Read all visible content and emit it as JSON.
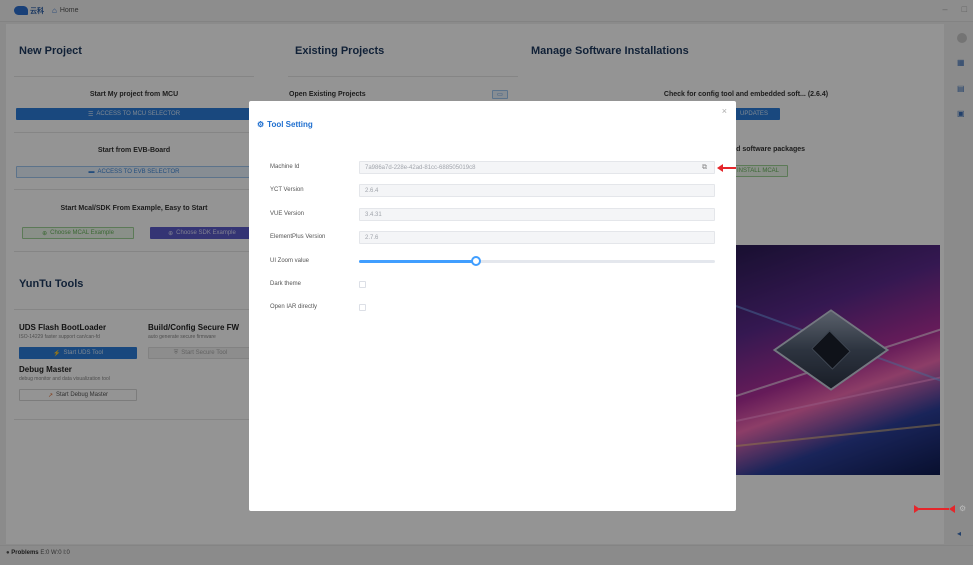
{
  "app": {
    "logo_text": "云科",
    "home_tab": "Home"
  },
  "sections": {
    "new_project": "New Project",
    "existing_projects": "Existing Projects",
    "manage": "Manage Software Installations",
    "yuntu_tools": "YunTu Tools"
  },
  "cards": {
    "mcu_title": "Start My project from MCU",
    "mcu_button": "ACCESS TO MCU SELECTOR",
    "evb_title": "Start from EVB-Board",
    "evb_button": "ACCESS TO EVB SELECTOR",
    "example_title": "Start Mcal/SDK From Example, Easy to Start",
    "mcal_example_button": "Choose MCAL Example",
    "sdk_example_button": "Choose SDK Example",
    "open_existing": "Open Existing Projects",
    "check_title": "Check for config tool and embedded soft... (2.6.4)",
    "updates_button": "UPDATES",
    "packages_title": "ded software packages",
    "install_mcal_button": "INSTALL MCAL"
  },
  "tools": {
    "uds_title": "UDS Flash BootLoader",
    "uds_sub": "ISO-14229 faster support can/can-fd",
    "uds_button": "Start UDS Tool",
    "secure_title": "Build/Config Secure FW",
    "secure_sub": "auto generate secure firmware",
    "secure_button": "Start Secure Tool",
    "debug_title": "Debug Master",
    "debug_sub": "debug monitor and data visualization tool",
    "debug_button": "Start Debug Master"
  },
  "status": {
    "problems_label": "Problems",
    "counts": "E:0 W:0 I:0"
  },
  "dialog": {
    "title": "Tool Setting",
    "close": "×",
    "machine_id_label": "Machine Id",
    "machine_id_value": "7a986a7d-228e-42ad-81cc-6885050​19c8",
    "yct_label": "YCT Version",
    "yct_value": "2.6.4",
    "vue_label": "VUE Version",
    "vue_value": "3.4.31",
    "element_label": "ElementPlus Version",
    "element_value": "2.7.6",
    "zoom_label": "UI Zoom value",
    "zoom_fraction": 0.33,
    "dark_label": "Dark theme",
    "dark_checked": false,
    "iar_label": "Open IAR directly",
    "iar_checked": false
  },
  "colors": {
    "accent": "#409eff",
    "primary_button": "#2b7dd9",
    "arrow": "#e5262b",
    "dialog_title": "#1f6fcf"
  }
}
